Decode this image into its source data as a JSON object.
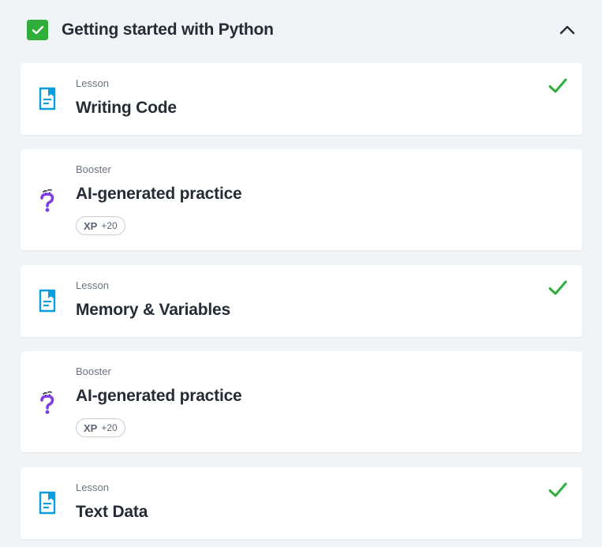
{
  "section": {
    "title": "Getting started with Python",
    "completed": true,
    "expanded": true,
    "accent_color": "#2fae3a"
  },
  "items": [
    {
      "type": "Lesson",
      "title": "Writing Code",
      "icon": "lesson-document-icon",
      "completed": true
    },
    {
      "type": "Booster",
      "title": "AI-generated practice",
      "icon": "question-mark-icon",
      "xp_label": "XP",
      "xp_value": "+20"
    },
    {
      "type": "Lesson",
      "title": "Memory & Variables",
      "icon": "lesson-document-icon",
      "completed": true
    },
    {
      "type": "Booster",
      "title": "AI-generated practice",
      "icon": "question-mark-icon",
      "xp_label": "XP",
      "xp_value": "+20"
    },
    {
      "type": "Lesson",
      "title": "Text Data",
      "icon": "lesson-document-icon",
      "completed": true
    }
  ],
  "colors": {
    "check_green": "#2fae3a",
    "lesson_icon_blue": "#0a9ee0",
    "booster_icon_purple": "#7e3fe0"
  }
}
